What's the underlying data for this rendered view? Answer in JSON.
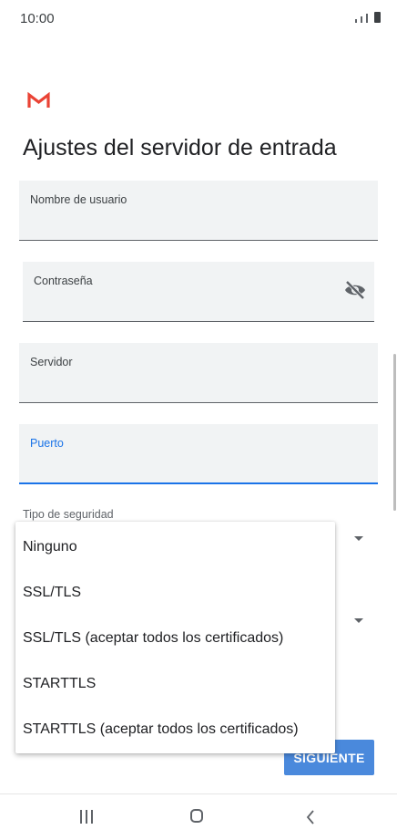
{
  "status_bar": {
    "time": "10:00"
  },
  "page": {
    "title": "Ajustes del servidor de entrada"
  },
  "fields": {
    "username": {
      "label": "Nombre de usuario",
      "value": ""
    },
    "password": {
      "label": "Contraseña",
      "value": ""
    },
    "server": {
      "label": "Servidor",
      "value": ""
    },
    "port": {
      "label": "Puerto",
      "value": ""
    }
  },
  "security": {
    "label": "Tipo de seguridad"
  },
  "dropdown_menu": {
    "options": [
      "Ninguno",
      "SSL/TLS",
      "SSL/TLS (aceptar todos los certificados)",
      "STARTTLS",
      "STARTTLS (aceptar todos los certificados)"
    ]
  },
  "buttons": {
    "next_label": "SIGUIENTE"
  },
  "colors": {
    "accent": "#1a73e8",
    "button": "#4a89dc",
    "gmail_red": "#ea4335"
  },
  "icons": [
    "gmail-logo",
    "eye-off-icon",
    "dropdown-arrow-icon",
    "recents-icon",
    "home-icon",
    "back-icon"
  ]
}
